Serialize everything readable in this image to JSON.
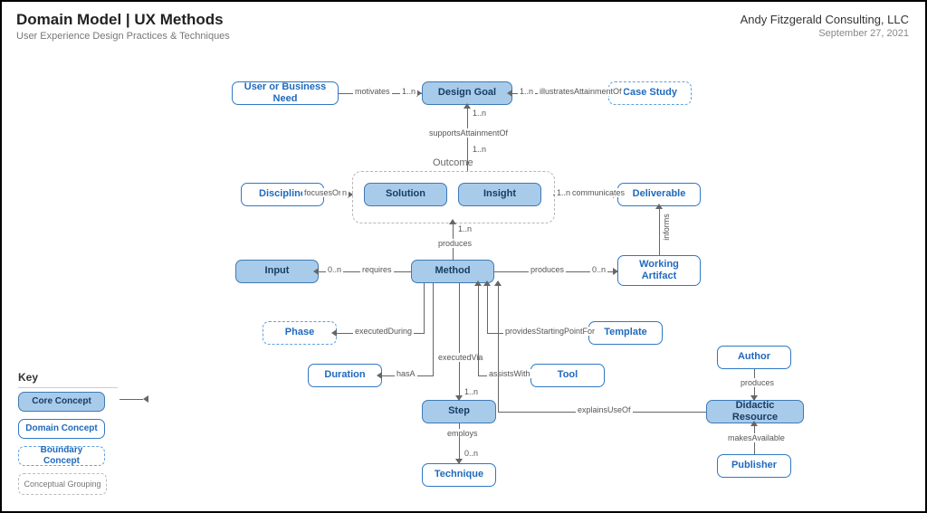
{
  "header": {
    "title": "Domain Model | UX Methods",
    "subtitle": "User Experience Design Practices & Techniques"
  },
  "meta": {
    "org": "Andy Fitzgerald Consulting, LLC",
    "date": "September 27, 2021"
  },
  "key": {
    "heading": "Key",
    "core": "Core Concept",
    "domain": "Domain Concept",
    "boundary": "Boundary Concept",
    "group": "Conceptual Grouping"
  },
  "group": {
    "outcome": "Outcome"
  },
  "nodes": {
    "userNeed": "User or Business Need",
    "designGoal": "Design Goal",
    "caseStudy": "Case Study",
    "discipline": "Discipline",
    "solution": "Solution",
    "insight": "Insight",
    "deliverable": "Deliverable",
    "input": "Input",
    "method": "Method",
    "workingArtifact": "Working Artifact",
    "phase": "Phase",
    "template": "Template",
    "duration": "Duration",
    "tool": "Tool",
    "author": "Author",
    "step": "Step",
    "didactic": "Didactic Resource",
    "technique": "Technique",
    "publisher": "Publisher"
  },
  "rel": {
    "motivates": "motivates",
    "illustrates": "illustratesAttainmentOf",
    "supports": "supportsAttainmentOf",
    "focusesOn": "focusesOn",
    "communicates": "communicates",
    "produces": "produces",
    "requires": "requires",
    "informs": "informs",
    "executedDuring": "executedDuring",
    "executedVia": "executedVia",
    "providesStart": "providesStartingPointFor",
    "hasA": "hasA",
    "assistsWith": "assistsWith",
    "employs": "employs",
    "explainsUseOf": "explainsUseOf",
    "makesAvailable": "makesAvailable"
  },
  "card": {
    "one_n": "1..n",
    "zero_n": "0..n",
    "n": "n"
  }
}
